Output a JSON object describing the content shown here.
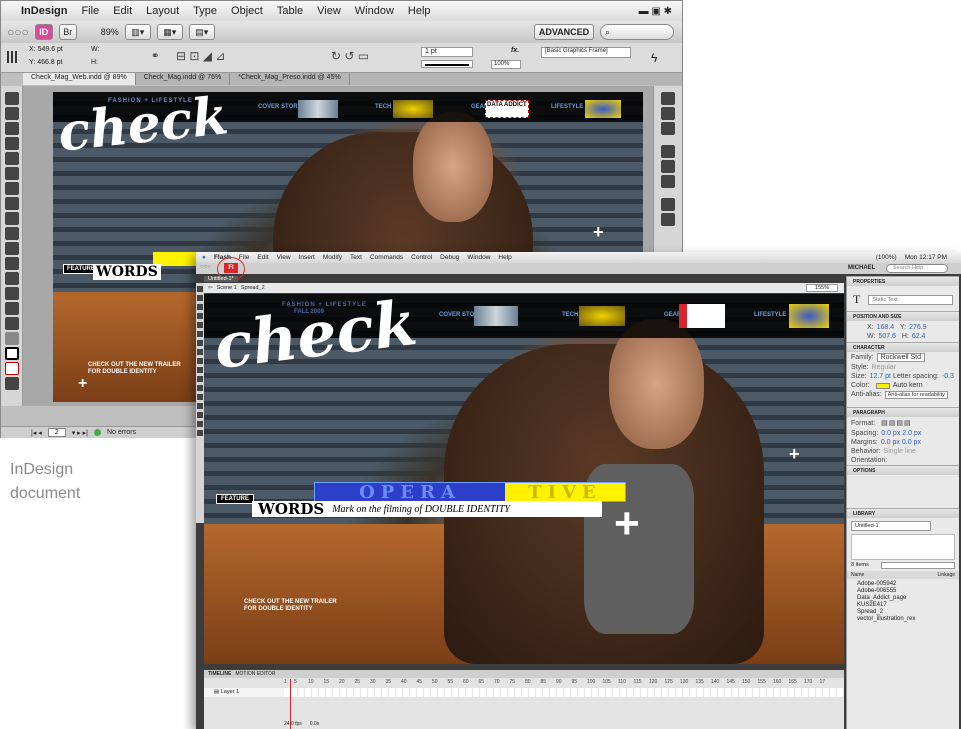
{
  "indesign": {
    "menubar": {
      "app_name": "InDesign",
      "items": [
        "File",
        "Edit",
        "Layout",
        "Type",
        "Object",
        "Table",
        "View",
        "Window",
        "Help"
      ]
    },
    "zoom": "89%",
    "workspace": "ADVANCED",
    "search_placeholder": "",
    "x_label": "X:",
    "x_value": "549.6 pt",
    "y_label": "Y:",
    "y_value": "466.8 pt",
    "w_label": "W:",
    "h_label": "H:",
    "stroke_weight": "1 pt",
    "opacity": "100%",
    "frame_style": "[Basic Graphics Frame]",
    "tabs": [
      "Check_Mag_Web.indd @ 89%",
      "Check_Mag.indd @ 76%",
      "*Check_Mag_Preso.indd @ 45%"
    ],
    "page_number": "2",
    "status": "No errors"
  },
  "caption": {
    "line1": "InDesign",
    "line2": "document"
  },
  "magazine": {
    "kicker": "FASHION + LIFESTYLE",
    "issue": "FALL 2009",
    "logo": "check",
    "nav": [
      "COVER STORY",
      "TECH",
      "GEAR",
      "LIFESTYLE"
    ],
    "data_addict": "DATA ADDICT",
    "feature_label": "FEATURE",
    "headline_left": "OPERA",
    "headline_right": "TIVE",
    "words": "WORDS",
    "subhead": "Mark on the filming of DOUBLE IDENTITY",
    "trailer_line1": "CHECK OUT THE NEW TRAILER",
    "trailer_line2": "FOR DOUBLE IDENTITY"
  },
  "flash": {
    "menubar": {
      "app_name": "Flash",
      "items": [
        "File",
        "Edit",
        "View",
        "Insert",
        "Modify",
        "Text",
        "Commands",
        "Control",
        "Debug",
        "Window",
        "Help"
      ]
    },
    "clock": "Mon 12:17 PM",
    "battery": "(100%)",
    "user": "MICHAEL",
    "search_placeholder": "Search Help",
    "doc_tab": "Untitled-1*",
    "breadcrumb": [
      "Scene 1",
      "Spread_2"
    ],
    "zoom": "155%",
    "properties": {
      "header": "PROPERTIES",
      "text_type": "Static Text",
      "position_size": "POSITION AND SIZE",
      "x_label": "X:",
      "x": "168.4",
      "y_label": "Y:",
      "y": "276.9",
      "w_label": "W:",
      "w": "507.6",
      "h_label": "H:",
      "h": "62.4",
      "character": "CHARACTER",
      "family_label": "Family:",
      "family": "Rockwell Std",
      "style_label": "Style:",
      "style": "Regular",
      "size_label": "Size:",
      "size": "12.7 pt",
      "letter_spacing_label": "Letter spacing:",
      "letter_spacing": "-0.3",
      "color_label": "Color:",
      "auto_kern": "Auto kern",
      "anti_alias_label": "Anti-alias:",
      "anti_alias": "Anti-alias for readability",
      "paragraph": "PARAGRAPH",
      "format_label": "Format:",
      "spacing_label": "Spacing:",
      "spacing_indent": "0.0 px",
      "spacing_line": "2.0 px",
      "margins_label": "Margins:",
      "margin_left": "0.0 px",
      "margin_right": "0.0 px",
      "behavior_label": "Behavior:",
      "behavior": "Single line",
      "orientation_label": "Orientation:",
      "options": "OPTIONS"
    },
    "library": {
      "header": "LIBRARY",
      "doc": "Untitled-1",
      "count": "8 items",
      "col_name": "Name",
      "col_linkage": "Linkage",
      "items": [
        "Adobe-005942",
        "Adobe-006555",
        "Data_Addict_page",
        "KUS2E417",
        "Spread_2",
        "vector_illustration_rex"
      ]
    },
    "timeline": {
      "tabs": [
        "TIMELINE",
        "MOTION EDITOR"
      ],
      "layer": "Layer 1",
      "frames": [
        "1",
        "5",
        "10",
        "15",
        "20",
        "25",
        "30",
        "35",
        "40",
        "45",
        "50",
        "55",
        "60",
        "65",
        "70",
        "75",
        "80",
        "85",
        "90",
        "95",
        "100",
        "105",
        "110",
        "115",
        "120",
        "125",
        "130",
        "135",
        "140",
        "145",
        "150",
        "155",
        "160",
        "165",
        "170",
        "17"
      ],
      "fps": "24.0 fps",
      "time": "0.0s"
    }
  },
  "colors": {
    "accent_blue": "#1f57c3",
    "highlight_yellow": "#fff200",
    "flash_red": "#d8262a",
    "headline_bg": "#2b3fc8"
  }
}
